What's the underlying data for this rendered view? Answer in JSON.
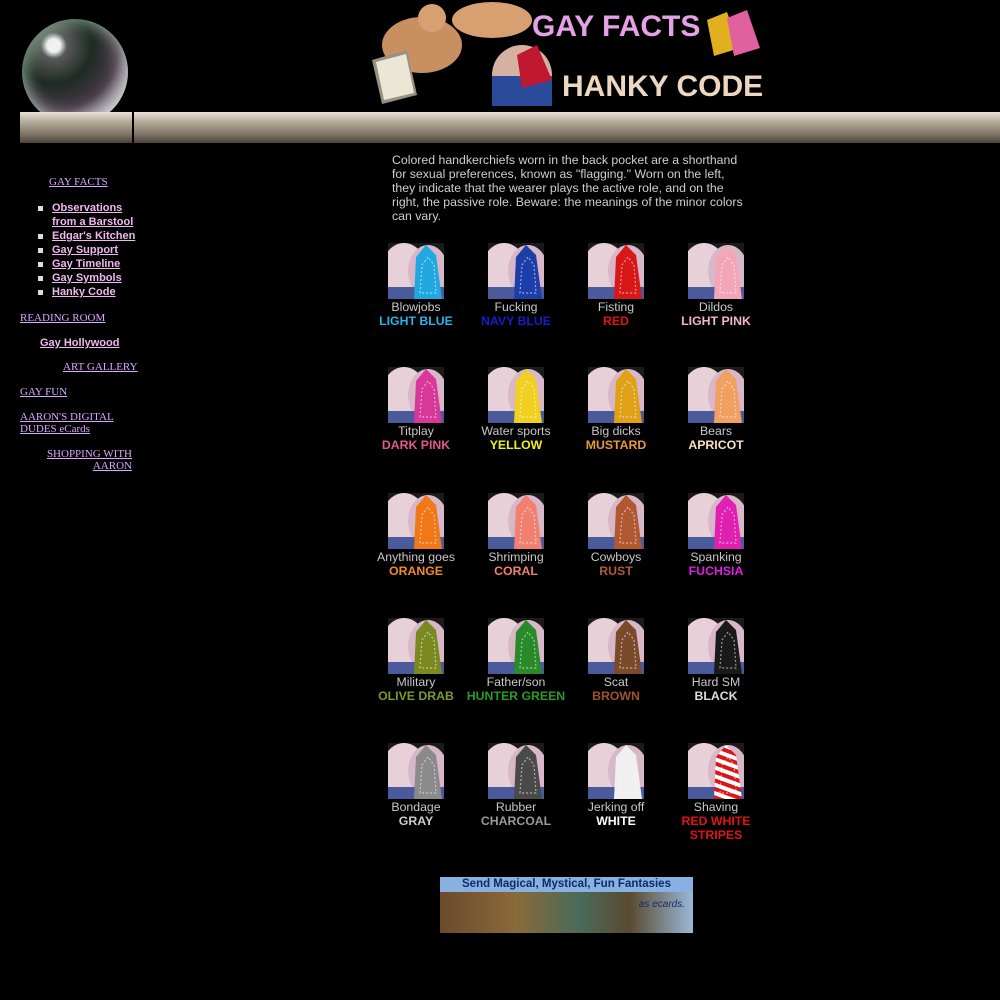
{
  "header": {
    "title_line1": "GAY FACTS",
    "title_line2": "HANKY CODE"
  },
  "sidebar": {
    "gay_facts": "GAY FACTS",
    "sub_items": [
      {
        "label": "Observations from a Barstool"
      },
      {
        "label": "Edgar's Kitchen"
      },
      {
        "label": "Gay Support"
      },
      {
        "label": "Gay Timeline"
      },
      {
        "label": "Gay Symbols"
      },
      {
        "label": "Hanky Code"
      }
    ],
    "reading_room": "READING ROOM",
    "gay_hollywood": "Gay Hollywood",
    "art_gallery": "ART GALLERY",
    "gay_fun": "GAY FUN",
    "digital_dudes": "AARON'S DIGITAL DUDES eCards",
    "shopping": "SHOPPING WITH AARON"
  },
  "intro": "Colored handkerchiefs worn in the back pocket are a shorthand for sexual preferences, known as \"flagging.\" Worn on the left, they indicate that the wearer plays the active role, and on the right, the passive role. Beware: the meanings of the minor colors can vary.",
  "hankies": [
    {
      "activity": "Blowjobs",
      "color_name": "LIGHT BLUE",
      "color": "#22a8e0",
      "text_color": "#2ab0ea"
    },
    {
      "activity": "Fucking",
      "color_name": "NAVY BLUE",
      "color": "#1c3ea8",
      "text_color": "#1a1acc"
    },
    {
      "activity": "Fisting",
      "color_name": "RED",
      "color": "#d81818",
      "text_color": "#e01414"
    },
    {
      "activity": "Dildos",
      "color_name": "LIGHT PINK",
      "color": "#f2a6b8",
      "text_color": "#f3b6c4"
    },
    {
      "activity": "Titplay",
      "color_name": "DARK PINK",
      "color": "#d8389a",
      "text_color": "#e05a90"
    },
    {
      "activity": "Water sports",
      "color_name": "YELLOW",
      "color": "#f0d020",
      "text_color": "#f0f020"
    },
    {
      "activity": "Big dicks",
      "color_name": "MUSTARD",
      "color": "#e0a018",
      "text_color": "#e49a3a"
    },
    {
      "activity": "Bears",
      "color_name": "APRICOT",
      "color": "#f0a060",
      "text_color": "#fae0c0"
    },
    {
      "activity": "Anything goes",
      "color_name": "ORANGE",
      "color": "#f07818",
      "text_color": "#f08a2a"
    },
    {
      "activity": "Shrimping",
      "color_name": "CORAL",
      "color": "#f08070",
      "text_color": "#f08070"
    },
    {
      "activity": "Cowboys",
      "color_name": "RUST",
      "color": "#b05830",
      "text_color": "#b05a3a"
    },
    {
      "activity": "Spanking",
      "color_name": "FUCHSIA",
      "color": "#e020b0",
      "text_color": "#e020e0"
    },
    {
      "activity": "Military",
      "color_name": "OLIVE DRAB",
      "color": "#7a8a20",
      "text_color": "#7a9a2a"
    },
    {
      "activity": "Father/son",
      "color_name": "HUNTER GREEN",
      "color": "#2a8a2a",
      "text_color": "#2a9a2a"
    },
    {
      "activity": "Scat",
      "color_name": "BROWN",
      "color": "#7a4a2a",
      "text_color": "#a0522d"
    },
    {
      "activity": "Hard SM",
      "color_name": "BLACK",
      "color": "#1a1a1a",
      "text_color": "#dddddd"
    },
    {
      "activity": "Bondage",
      "color_name": "GRAY",
      "color": "#8a8a8a",
      "text_color": "#cccccc"
    },
    {
      "activity": "Rubber",
      "color_name": "CHARCOAL",
      "color": "#4a4a4a",
      "text_color": "#9a9a9a"
    },
    {
      "activity": "Jerking off",
      "color_name": "WHITE",
      "color": "#f0f0f0",
      "text_color": "#ffffff"
    },
    {
      "activity": "Shaving",
      "color_name": "RED WHITE STRIPES",
      "color": "#d81818",
      "text_color": "#e01414"
    }
  ],
  "ecard": {
    "title": "Send Magical, Mystical, Fun Fantasies",
    "side_text": "as ecards."
  }
}
